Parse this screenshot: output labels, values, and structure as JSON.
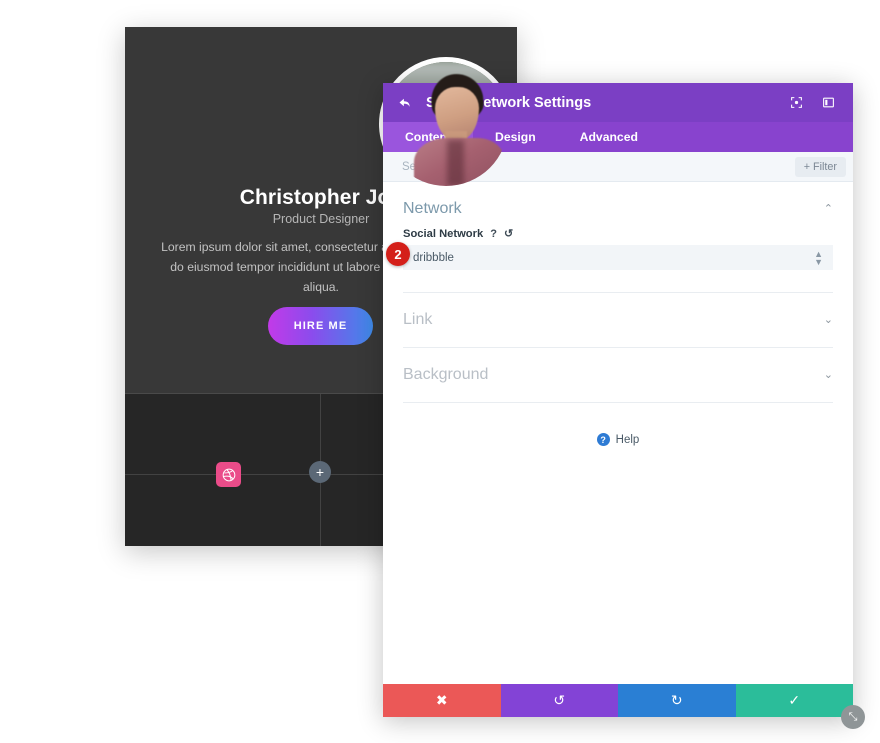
{
  "profile_card": {
    "name": "Christopher Joe",
    "role": "Product Designer",
    "bio": "Lorem ipsum dolor sit amet, consectetur adipiscing elit, sed do eiusmod tempor incididunt ut labore et dolore magna aliqua.",
    "cta_label": "HIRE ME",
    "cta_gradient_from": "#c23ae8",
    "cta_gradient_to": "#3e8ae8",
    "card_bg": "#383838",
    "card_footer_bg": "#262626",
    "social_icon": {
      "name": "dribbble-icon",
      "color": "#ea4c89"
    },
    "add_button_label": "+"
  },
  "settings_modal": {
    "header": {
      "back_icon": "back-arrow-icon",
      "title": "Social Network Settings",
      "bg": "#7b3fc4",
      "actions": [
        {
          "name": "fullscreen-icon",
          "glyph": "⬚"
        },
        {
          "name": "layout-panel-icon",
          "glyph": "◫"
        }
      ]
    },
    "tabs": [
      {
        "label": "Content",
        "active": true
      },
      {
        "label": "Design",
        "active": false
      },
      {
        "label": "Advanced",
        "active": false
      }
    ],
    "search": {
      "placeholder": "Search Options",
      "value": "",
      "filter_label": "+ Filter"
    },
    "sections": [
      {
        "title": "Network",
        "expanded": true,
        "chevron": "⌃"
      },
      {
        "title": "Link",
        "expanded": false,
        "chevron": "⌄"
      },
      {
        "title": "Background",
        "expanded": false,
        "chevron": "⌄"
      }
    ],
    "network_field": {
      "label": "Social Network",
      "help_glyph": "?",
      "reset_glyph": "↺",
      "value": "dribbble",
      "badge": "2",
      "badge_color": "#d4201a"
    },
    "help": {
      "glyph": "?",
      "label": "Help"
    },
    "footer_buttons": [
      {
        "name": "cancel-button",
        "glyph": "✖",
        "color": "#eb5857"
      },
      {
        "name": "undo-button",
        "glyph": "↺",
        "color": "#8343d6"
      },
      {
        "name": "redo-button",
        "glyph": "↻",
        "color": "#2a7fd4"
      },
      {
        "name": "save-button",
        "glyph": "✓",
        "color": "#2bbd9a"
      }
    ],
    "resize_handle_glyph": "⤡"
  }
}
